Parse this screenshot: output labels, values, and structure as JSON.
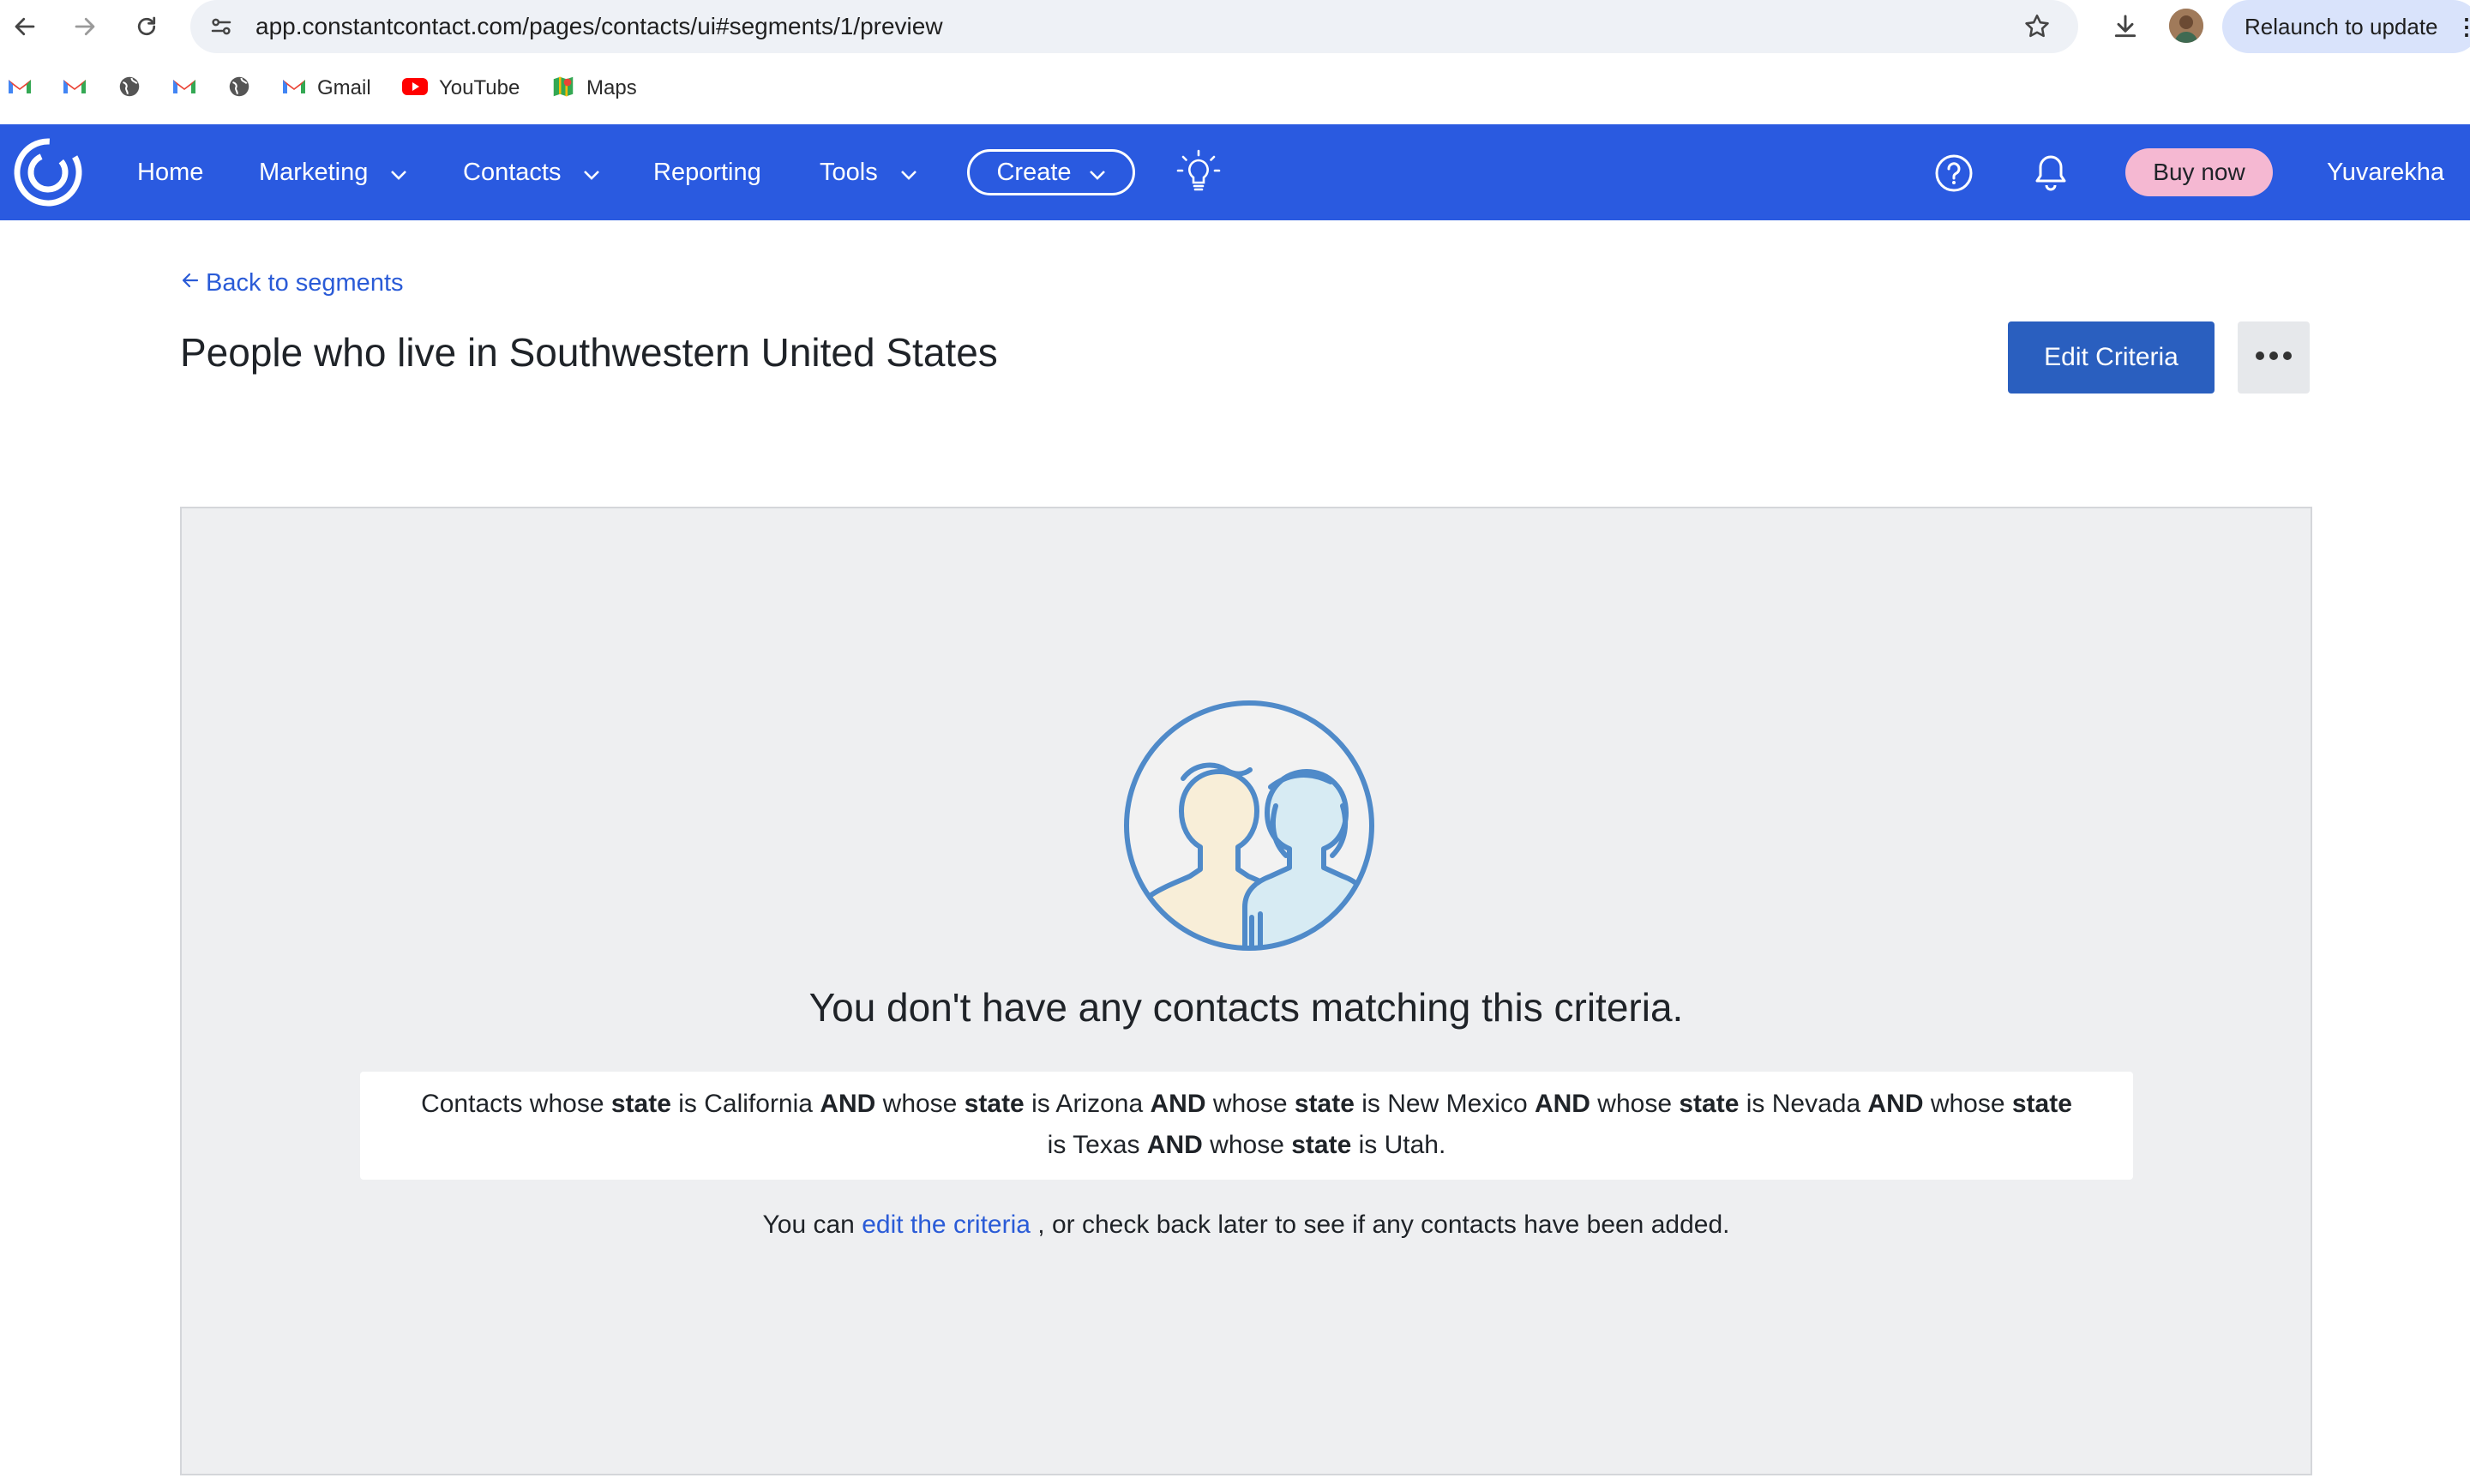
{
  "browser": {
    "url": "app.constantcontact.com/pages/contacts/ui#segments/1/preview",
    "relaunch_label": "Relaunch to update",
    "bookmarks": [
      {
        "icon": "gmail-icon",
        "label": ""
      },
      {
        "icon": "gmail-icon",
        "label": ""
      },
      {
        "icon": "globe-icon",
        "label": ""
      },
      {
        "icon": "gmail-icon",
        "label": ""
      },
      {
        "icon": "globe-icon",
        "label": ""
      },
      {
        "icon": "gmail-icon",
        "label": "Gmail"
      },
      {
        "icon": "youtube-icon",
        "label": "YouTube"
      },
      {
        "icon": "maps-icon",
        "label": "Maps"
      }
    ]
  },
  "nav": {
    "items": [
      "Home",
      "Marketing",
      "Contacts",
      "Reporting",
      "Tools"
    ],
    "create_label": "Create",
    "buy_label": "Buy now",
    "user_name": "Yuvarekha",
    "brand_color": "#2a5ae0"
  },
  "page": {
    "back_label": "Back to segments",
    "title": "People who live in Southwestern United States",
    "edit_label": "Edit Criteria",
    "more_icon": "more-horizontal-icon"
  },
  "empty_state": {
    "heading": "You don't have any contacts matching this criteria.",
    "criteria": [
      {
        "text": "Contacts whose ",
        "bold": false
      },
      {
        "text": "state",
        "bold": true
      },
      {
        "text": " is California ",
        "bold": false
      },
      {
        "text": "AND",
        "bold": true
      },
      {
        "text": " whose ",
        "bold": false
      },
      {
        "text": "state",
        "bold": true
      },
      {
        "text": " is Arizona ",
        "bold": false
      },
      {
        "text": "AND",
        "bold": true
      },
      {
        "text": " whose ",
        "bold": false
      },
      {
        "text": "state",
        "bold": true
      },
      {
        "text": " is New Mexico ",
        "bold": false
      },
      {
        "text": "AND",
        "bold": true
      },
      {
        "text": " whose ",
        "bold": false
      },
      {
        "text": "state",
        "bold": true
      },
      {
        "text": " is Nevada ",
        "bold": false
      },
      {
        "text": "AND",
        "bold": true
      },
      {
        "text": " whose ",
        "bold": false
      },
      {
        "text": "state",
        "bold": true
      },
      {
        "text": " is Texas ",
        "bold": false
      },
      {
        "text": "AND",
        "bold": true
      },
      {
        "text": " whose ",
        "bold": false
      },
      {
        "text": "state",
        "bold": true
      },
      {
        "text": " is Utah.",
        "bold": false
      }
    ],
    "hint_before": "You can ",
    "hint_link": "edit the criteria",
    "hint_after": " , or check back later to see if any contacts have been added."
  }
}
